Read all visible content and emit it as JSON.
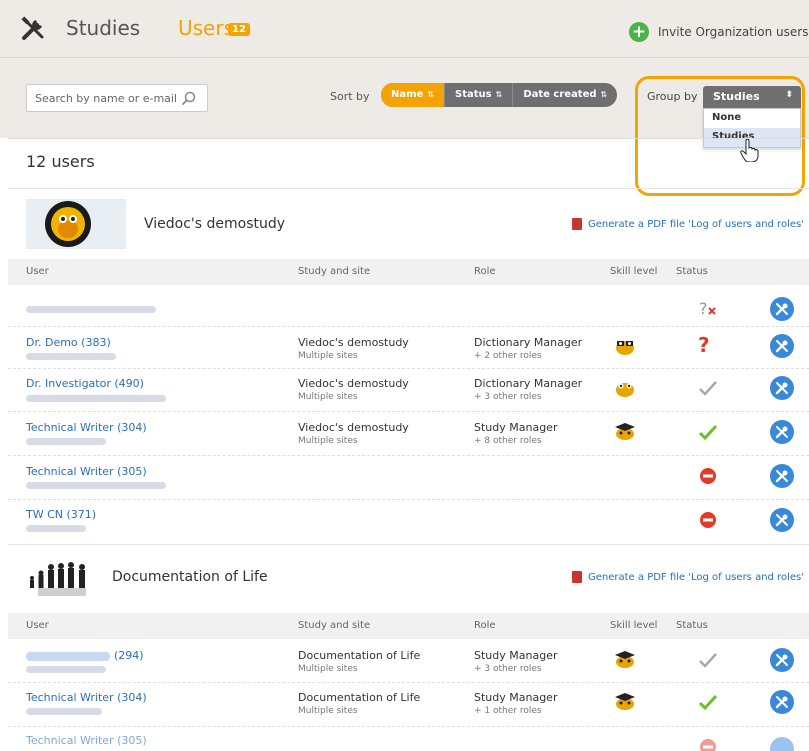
{
  "header": {
    "studies_tab": "Studies",
    "users_tab": "Users",
    "users_count_badge": "12",
    "invite_label": "Invite Organization users"
  },
  "toolbar": {
    "search_placeholder": "Search by name or e-mail",
    "sort_by_label": "Sort by",
    "sort_options": [
      "Name",
      "Status",
      "Date created"
    ],
    "sort_active": "Name",
    "group_by_label": "Group by",
    "group_by_selected": "Studies",
    "group_by_options": [
      "None",
      "Studies"
    ]
  },
  "users_count_label": "12 users",
  "columns": [
    "User",
    "Study and site",
    "Role",
    "Skill level",
    "Status"
  ],
  "pdf_link_label": "Generate a PDF file 'Log of users and roles'",
  "groups": [
    {
      "study_name": "Viedoc's demostudy",
      "rows": [
        {
          "name": "",
          "study": "",
          "site": "",
          "role": "",
          "role_sub": "",
          "skill": "",
          "status": "unknown-x"
        },
        {
          "name": "Dr. Demo (383)",
          "study": "Viedoc's demostudy",
          "site": "Multiple sites",
          "role": "Dictionary Manager",
          "role_sub": "+ 2 other roles",
          "skill": "glasses",
          "status": "question"
        },
        {
          "name": "Dr. Investigator (490)",
          "study": "Viedoc's demostudy",
          "site": "Multiple sites",
          "role": "Dictionary Manager",
          "role_sub": "+ 3 other roles",
          "skill": "plain",
          "status": "check-grey"
        },
        {
          "name": "Technical Writer (304)",
          "study": "Viedoc's demostudy",
          "site": "Multiple sites",
          "role": "Study Manager",
          "role_sub": "+ 8 other roles",
          "skill": "graduate",
          "status": "check-green"
        },
        {
          "name": "Technical Writer (305)",
          "study": "",
          "site": "",
          "role": "",
          "role_sub": "",
          "skill": "",
          "status": "blocked"
        },
        {
          "name": "TW CN (371)",
          "study": "",
          "site": "",
          "role": "",
          "role_sub": "",
          "skill": "",
          "status": "blocked"
        }
      ]
    },
    {
      "study_name": "Documentation of Life",
      "rows": [
        {
          "name": "(294)",
          "study": "Documentation of Life",
          "site": "Multiple sites",
          "role": "Study Manager",
          "role_sub": "+ 3 other roles",
          "skill": "graduate",
          "status": "check-grey"
        },
        {
          "name": "Technical Writer (304)",
          "study": "Documentation of Life",
          "site": "Multiple sites",
          "role": "Study Manager",
          "role_sub": "+ 1 other roles",
          "skill": "graduate",
          "status": "check-green"
        },
        {
          "name": "Technical Writer (305)",
          "study": "",
          "site": "",
          "role": "",
          "role_sub": "",
          "skill": "",
          "status": "blocked"
        }
      ]
    }
  ],
  "colors": {
    "accent": "#f4a300",
    "link": "#2a6ebb",
    "action": "#3a88d8",
    "success": "#6cc02c",
    "danger": "#e03a2b",
    "muted": "#9a9a9a"
  }
}
